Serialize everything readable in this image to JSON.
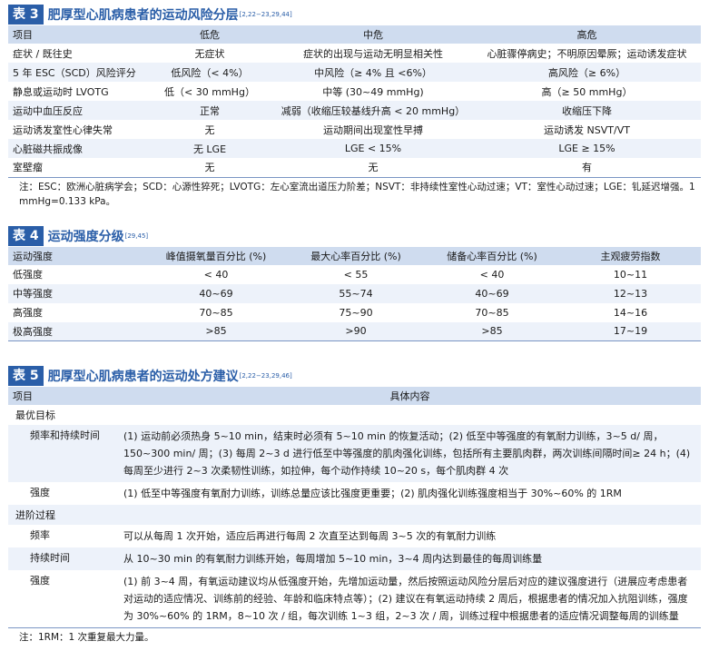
{
  "table3": {
    "badge": "表 3",
    "title": "肥厚型心肌病患者的运动风险分层",
    "ref": "[2,22−23,29,44]",
    "headers": [
      "项目",
      "低危",
      "中危",
      "高危"
    ],
    "rows": [
      [
        "症状 / 既往史",
        "无症状",
        "症状的出现与运动无明显相关性",
        "心脏骤停病史；不明原因晕厥；运动诱发症状"
      ],
      [
        "5 年 ESC（SCD）风险评分",
        "低风险（< 4%）",
        "中风险（≥ 4% 且 <6%）",
        "高风险（≥ 6%）"
      ],
      [
        "静息或运动时 LVOTG",
        "低（< 30 mmHg）",
        "中等 (30~49 mmHg)",
        "高（≥ 50 mmHg）"
      ],
      [
        "运动中血压反应",
        "正常",
        "减弱（收缩压较基线升高 < 20 mmHg）",
        "收缩压下降"
      ],
      [
        "运动诱发室性心律失常",
        "无",
        "运动期间出现室性早搏",
        "运动诱发 NSVT/VT"
      ],
      [
        "心脏磁共振成像",
        "无 LGE",
        "LGE < 15%",
        "LGE ≥ 15%"
      ],
      [
        "室壁瘤",
        "无",
        "无",
        "有"
      ]
    ],
    "note": "注：ESC：欧洲心脏病学会；SCD：心源性猝死；LVOTG：左心室流出道压力阶差；NSVT：非持续性室性心动过速；VT：室性心动过速；LGE：钆延迟增强。1 mmHg=0.133 kPa。"
  },
  "table4": {
    "badge": "表 4",
    "title": "运动强度分级",
    "ref": "[29,45]",
    "headers": [
      "运动强度",
      "峰值摄氧量百分比 (%)",
      "最大心率百分比 (%)",
      "储备心率百分比 (%)",
      "主观疲劳指数"
    ],
    "rows": [
      [
        "低强度",
        "< 40",
        "< 55",
        "< 40",
        "10~11"
      ],
      [
        "中等强度",
        "40~69",
        "55~74",
        "40~69",
        "12~13"
      ],
      [
        "高强度",
        "70~85",
        "75~90",
        "70~85",
        "14~16"
      ],
      [
        "极高强度",
        ">85",
        ">90",
        ">85",
        "17~19"
      ]
    ]
  },
  "table5": {
    "badge": "表 5",
    "title": "肥厚型心肌病患者的运动处方建议",
    "ref": "[2,22−23,29,46]",
    "headers": [
      "项目",
      "具体内容"
    ],
    "section1": "最优目标",
    "freq_label": "频率和持续时间",
    "freq_content": "(1) 运动前必须热身 5~10 min，结束时必须有 5~10 min 的恢复活动；(2) 低至中等强度的有氧耐力训练，3~5 d/ 周，150~300 min/ 周；(3) 每周 2~3 d 进行低至中等强度的肌肉强化训练，包括所有主要肌肉群，两次训练间隔时间≥ 24 h；(4) 每周至少进行 2~3 次柔韧性训练，如拉伸，每个动作持续 10~20 s，每个肌肉群 4 次",
    "intensity_label": "强度",
    "intensity_content": "(1) 低至中等强度有氧耐力训练，训练总量应该比强度更重要；(2) 肌肉强化训练强度相当于 30%~60% 的 1RM",
    "section2": "进阶过程",
    "freq2_label": "频率",
    "freq2_content": "可以从每周 1 次开始，适应后再进行每周 2 次直至达到每周 3~5 次的有氧耐力训练",
    "dur_label": "持续时间",
    "dur_content": "从 10~30 min 的有氧耐力训练开始，每周增加 5~10 min，3~4 周内达到最佳的每周训练量",
    "int2_label": "强度",
    "int2_content": "(1) 前 3~4 周，有氧运动建议均从低强度开始，先增加运动量，然后按照运动风险分层后对应的建议强度进行（进展应考虑患者对运动的适应情况、训练前的经验、年龄和临床特点等）；(2) 建议在有氧运动持续 2 周后，根据患者的情况加入抗阻训练，强度为 30%~60% 的 1RM，8~10 次 / 组，每次训练 1~3 组，2~3 次 / 周，训练过程中根据患者的适应情况调整每周的训练量",
    "note": "注：1RM：1 次重复最大力量。"
  }
}
